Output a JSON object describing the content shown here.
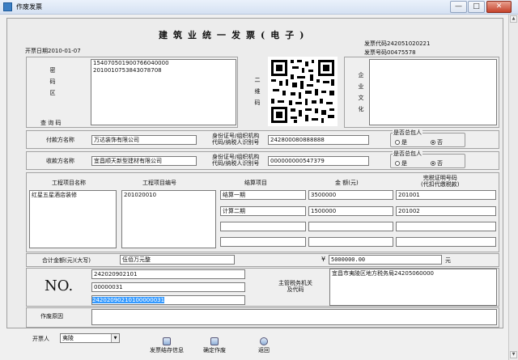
{
  "window": {
    "title": "作废发票",
    "minimize": "—",
    "maximize": "□",
    "close": "✕"
  },
  "header": {
    "title": "建筑业统一发票(电子)",
    "date_label": "开票日期",
    "date": "2010-01-07",
    "code_label": "发票代码",
    "code": "242051020221",
    "number_label": "发票号码",
    "number": "00475578"
  },
  "cipher": {
    "label": "密码区",
    "lines": [
      "154070501900766040000",
      "2010010753843078708"
    ],
    "query_label": "查 询 码",
    "qr_label": "二维码"
  },
  "enterprise": {
    "label": "企业文化"
  },
  "payer": {
    "label": "付款方名称",
    "name": "万达装饰有限公司",
    "id_label_1": "身份证号/组织机构",
    "id_label_2": "代码/纳税人识别号",
    "id": "242800080888888",
    "group_label": "是否总包人",
    "yes": "是",
    "no": "否",
    "selected": "no"
  },
  "payee": {
    "label": "收款方名称",
    "name": "宜昌顺天新型建材有限公司",
    "id_label_1": "身份证号/组织机构",
    "id_label_2": "代码/纳税人识别号",
    "id": "000000000547379",
    "group_label": "是否总包人",
    "yes": "是",
    "no": "否",
    "selected": "no"
  },
  "items": {
    "col_project_name": "工程项目名称",
    "col_project_code": "工程项目编号",
    "col_settlement": "结算项目",
    "col_amount": "金 额(元)",
    "col_tax_1": "完税证明号码",
    "col_tax_2": "(代扣代缴税款)",
    "project_name": "红星五星酒店装修",
    "project_code": "201020010",
    "rows": [
      {
        "settlement": "结算一期",
        "amount": "3500000",
        "tax": "201001"
      },
      {
        "settlement": "计算二期",
        "amount": "1500000",
        "tax": "201002"
      },
      {
        "settlement": "",
        "amount": "",
        "tax": ""
      },
      {
        "settlement": "",
        "amount": "",
        "tax": ""
      }
    ]
  },
  "total": {
    "label": "合计金额(元)(大写)",
    "words": "伍佰万元整",
    "currency": "¥",
    "value": "5000000.00",
    "unit": "元"
  },
  "number_block": {
    "no_label": "NO.",
    "line1": "242020902101",
    "line2": "00000031",
    "line3": "24202090210100000031",
    "authority_label_1": "主管税务机关",
    "authority_label_2": "及代码",
    "authority": "宜昌市夷陵区地方税务局24205060000"
  },
  "void": {
    "label": "作废原因",
    "value": ""
  },
  "footer": {
    "issuer_label": "开票人",
    "issuer": "夷陵",
    "btn_save": "发票结存信息",
    "btn_void": "确定作废",
    "btn_back": "返回"
  }
}
